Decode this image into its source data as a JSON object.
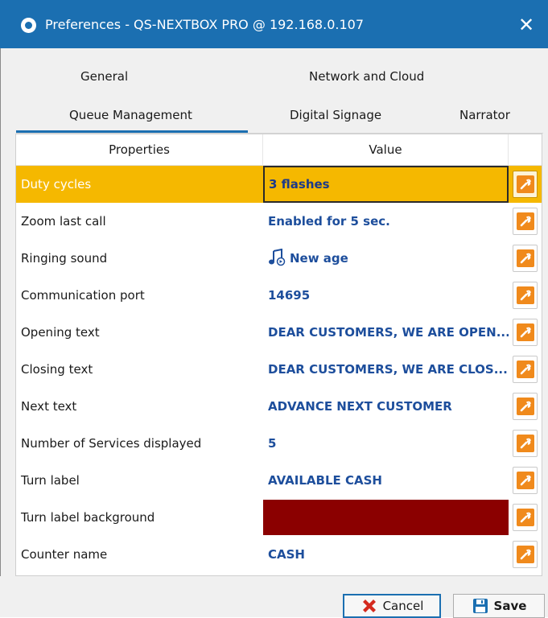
{
  "window": {
    "title": "Preferences - QS-NEXTBOX PRO @ 192.168.0.107",
    "close_glyph": "✕"
  },
  "tabs": [
    {
      "label": "General",
      "active": false
    },
    {
      "label": "Network and Cloud",
      "active": false
    },
    {
      "label": "Queue Management",
      "active": true
    },
    {
      "label": "Digital Signage",
      "active": false
    },
    {
      "label": "Narrator",
      "active": false
    }
  ],
  "grid": {
    "header": {
      "property": "Properties",
      "value": "Value"
    },
    "rows": [
      {
        "property": "Duty cycles",
        "value": "3 flashes",
        "selected": true
      },
      {
        "property": "Zoom last call",
        "value": "Enabled for 5 sec."
      },
      {
        "property": "Ringing sound",
        "value": "New age",
        "icon": "music-note-icon"
      },
      {
        "property": "Communication port",
        "value": "14695"
      },
      {
        "property": "Opening text",
        "value": "DEAR CUSTOMERS, WE ARE OPEN..."
      },
      {
        "property": "Closing text",
        "value": "DEAR CUSTOMERS, WE ARE CLOS..."
      },
      {
        "property": "Next text",
        "value": "ADVANCE NEXT CUSTOMER"
      },
      {
        "property": "Number of Services displayed",
        "value": "5"
      },
      {
        "property": "Turn label",
        "value": "AVAILABLE CASH"
      },
      {
        "property": "Turn label background",
        "value": "",
        "color": "#8b0000"
      },
      {
        "property": "Counter name",
        "value": "CASH"
      }
    ]
  },
  "footer": {
    "cancel_label": "Cancel",
    "save_label": "Save"
  },
  "colors": {
    "titlebar": "#1b6fb1",
    "selected_row": "#f5b800",
    "value_text": "#1d4e9c",
    "edit_button": "#f08a1c",
    "cancel_icon": "#d42a1e",
    "save_icon": "#1b6fb1"
  }
}
